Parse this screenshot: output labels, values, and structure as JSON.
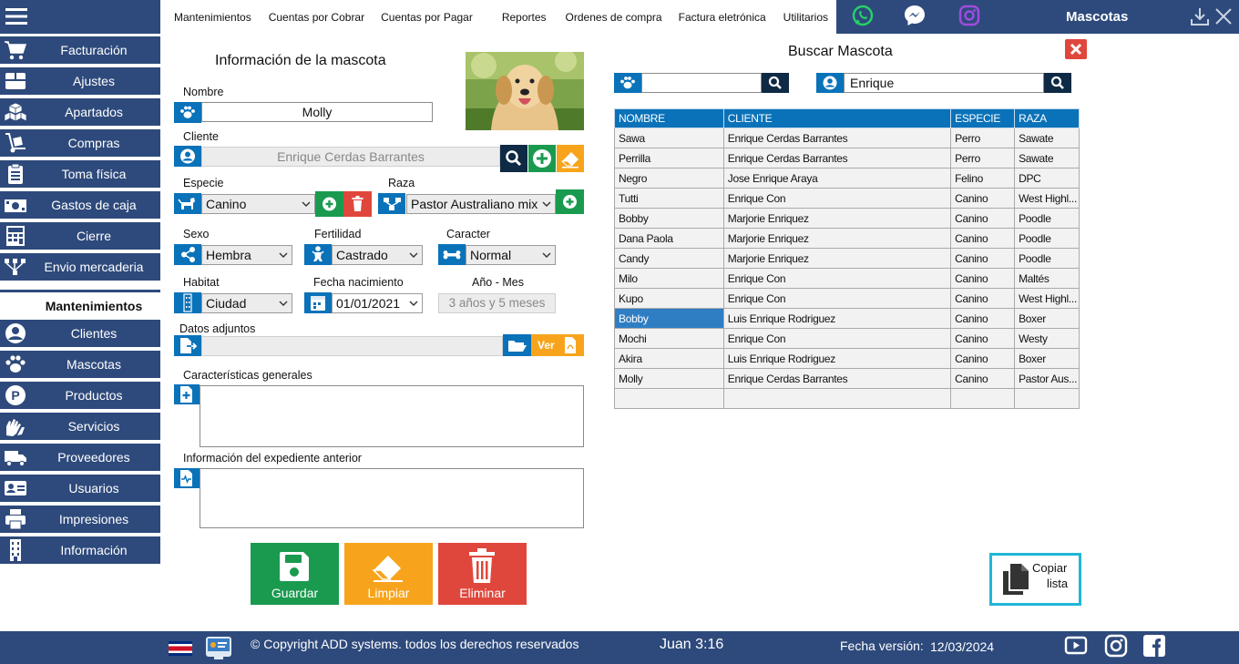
{
  "topnav": [
    "Mantenimientos",
    "Cuentas por Cobrar",
    "Cuentas por Pagar",
    "Reportes",
    "Ordenes de compra",
    "Factura eletrónica",
    "Utilitarios"
  ],
  "window_title": "Mascotas",
  "sidebar": {
    "items": [
      {
        "label": "Facturación",
        "icon": "cart-icon"
      },
      {
        "label": "Ajustes",
        "icon": "box-icon"
      },
      {
        "label": "Apartados",
        "icon": "boxes-icon"
      },
      {
        "label": "Compras",
        "icon": "dolly-icon"
      },
      {
        "label": "Toma física",
        "icon": "clipboard-icon"
      },
      {
        "label": "Gastos de caja",
        "icon": "money-icon"
      },
      {
        "label": "Cierre",
        "icon": "calculator-icon"
      },
      {
        "label": "Envio mercaderia",
        "icon": "network-icon"
      }
    ],
    "section_title": "Mantenimientos",
    "items2": [
      {
        "label": "Clientes",
        "icon": "user-icon"
      },
      {
        "label": "Mascotas",
        "icon": "paw-icon"
      },
      {
        "label": "Productos",
        "icon": "product-icon"
      },
      {
        "label": "Servicios",
        "icon": "hands-icon"
      },
      {
        "label": "Proveedores",
        "icon": "truck-icon"
      },
      {
        "label": "Usuarios",
        "icon": "id-card-icon"
      },
      {
        "label": "Impresiones",
        "icon": "printer-icon"
      },
      {
        "label": "Información",
        "icon": "building-icon"
      }
    ]
  },
  "form": {
    "title": "Información de la mascota",
    "nombre_label": "Nombre",
    "nombre_value": "Molly",
    "cliente_label": "Cliente",
    "cliente_value": "Enrique Cerdas Barrantes",
    "especie_label": "Especie",
    "especie_value": "Canino",
    "raza_label": "Raza",
    "raza_value": "Pastor Australiano mix",
    "sexo_label": "Sexo",
    "sexo_value": "Hembra",
    "fertilidad_label": "Fertilidad",
    "fertilidad_value": "Castrado",
    "caracter_label": "Caracter",
    "caracter_value": "Normal",
    "habitat_label": "Habitat",
    "habitat_value": "Ciudad",
    "fecha_label": "Fecha nacimiento",
    "fecha_value": "01/01/2021",
    "edad_label": "Año - Mes",
    "edad_value": "3 años y 5 meses",
    "adjuntos_label": "Datos adjuntos",
    "ver_label": "Ver",
    "caracteristicas_label": "Características generales",
    "expediente_label": "Información del expediente anterior",
    "guardar": "Guardar",
    "limpiar": "Limpiar",
    "eliminar": "Eliminar"
  },
  "search": {
    "title": "Buscar Mascota",
    "pet_query": "",
    "client_query": "Enrique",
    "columns": [
      "NOMBRE",
      "CLIENTE",
      "ESPECIE",
      "RAZA"
    ],
    "rows": [
      [
        "Sawa",
        "Enrique Cerdas Barrantes",
        "Perro",
        "Sawate"
      ],
      [
        "Perrilla",
        "Enrique Cerdas Barrantes",
        "Perro",
        "Sawate"
      ],
      [
        "Negro",
        "Jose Enrique Araya",
        "Felino",
        "DPC"
      ],
      [
        "Tutti",
        "Enrique Con",
        "Canino",
        "West Highl..."
      ],
      [
        "Bobby",
        "Marjorie Enriquez",
        "Canino",
        "Poodle"
      ],
      [
        "Dana Paola",
        "Marjorie Enriquez",
        "Canino",
        "Poodle"
      ],
      [
        "Candy",
        "Marjorie Enriquez",
        "Canino",
        "Poodle"
      ],
      [
        "Milo",
        "Enrique Con",
        "Canino",
        "Maltés"
      ],
      [
        "Kupo",
        "Enrique Con",
        "Canino",
        "West Highl..."
      ],
      [
        "Bobby",
        "Luis Enrique Rodriguez",
        "Canino",
        "Boxer"
      ],
      [
        "Mochi",
        "Enrique Con",
        "Canino",
        "Westy"
      ],
      [
        "Akira",
        "Luis Enrique Rodriguez",
        "Canino",
        "Boxer"
      ],
      [
        "Molly",
        "Enrique Cerdas Barrantes",
        "Canino",
        "Pastor Aus..."
      ],
      [
        "",
        "",
        "",
        ""
      ]
    ],
    "selected_row": 9,
    "copy_label_1": "Copiar",
    "copy_label_2": "lista"
  },
  "footer": {
    "copyright": "© Copyright ADD systems. todos los derechos reservados",
    "verse": "Juan 3:16",
    "version_label": "Fecha versión:",
    "version_date": "12/03/2024"
  },
  "colors": {
    "navy": "#2e4a7c",
    "blue": "#0a72b9",
    "green": "#1a9a4f",
    "orange": "#f7a41c",
    "red": "#e0473c",
    "dark": "#0f2a44"
  }
}
